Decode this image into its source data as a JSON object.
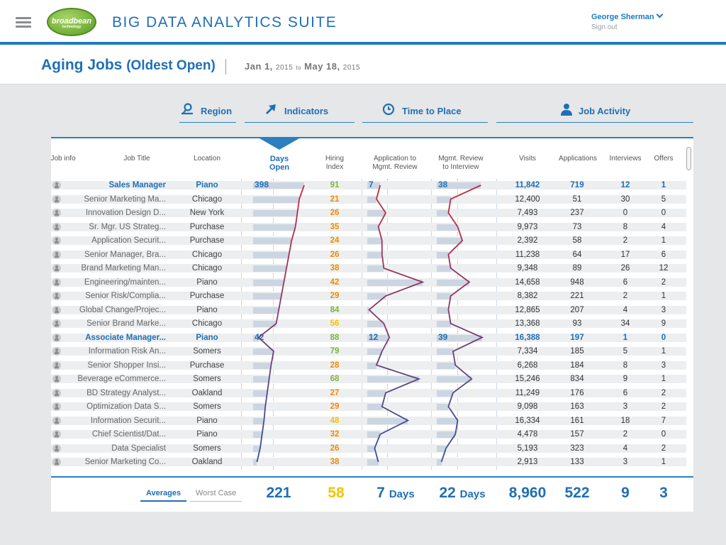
{
  "app": {
    "logo_text": "broadbean",
    "logo_sub": "technology",
    "title": "BIG DATA ANALYTICS SUITE",
    "user": "George Sherman",
    "signout": "Sign out"
  },
  "page": {
    "title": "Aging Jobs",
    "subtitle": "(Oldest Open)",
    "date_from": "Jan 1,",
    "year_from": "2015",
    "to": "to",
    "date_to": "May 18,",
    "year_to": "2015"
  },
  "tabs": [
    {
      "label": "Region",
      "icon": "map-pin-icon"
    },
    {
      "label": "Indicators",
      "icon": "arrow-up-right-icon"
    },
    {
      "label": "Time to Place",
      "icon": "clock-icon"
    },
    {
      "label": "Job Activity",
      "icon": "person-icon"
    }
  ],
  "columns": {
    "job_info": "Job info",
    "job_title": "Job Title",
    "location": "Location",
    "days_open_1": "Days",
    "days_open_2": "Open",
    "hiring_1": "Hiring",
    "hiring_2": "Index",
    "app_1": "Application to",
    "app_2": "Mgmt. Review",
    "mgmt_1": "Mgmt. Review",
    "mgmt_2": "to Interview",
    "visits": "Visits",
    "applications": "Applications",
    "interviews": "Interviews",
    "offers": "Offers"
  },
  "rows": [
    {
      "title": "Sales Manager",
      "location": "Piano",
      "days": 398,
      "hiring": 91,
      "app": 7,
      "mgmt": 38,
      "visits": "11,842",
      "applications": "719",
      "interviews": "12",
      "offers": "1",
      "highlight": true
    },
    {
      "title": "Senior Marketing Ma...",
      "location": "Chicago",
      "days": 360,
      "hiring": 21,
      "app": 5,
      "mgmt": 12,
      "visits": "12,400",
      "applications": "51",
      "interviews": "30",
      "offers": "5",
      "highlight": false
    },
    {
      "title": "Innovation Design D...",
      "location": "New York",
      "days": 345,
      "hiring": 26,
      "app": 10,
      "mgmt": 10,
      "visits": "7,493",
      "applications": "237",
      "interviews": "0",
      "offers": "0",
      "highlight": false
    },
    {
      "title": "Sr. Mgr. US Strateg...",
      "location": "Purchase",
      "days": 330,
      "hiring": 35,
      "app": 6,
      "mgmt": 18,
      "visits": "9,973",
      "applications": "73",
      "interviews": "8",
      "offers": "4",
      "highlight": false
    },
    {
      "title": "Application Securit...",
      "location": "Purchase",
      "days": 300,
      "hiring": 24,
      "app": 8,
      "mgmt": 22,
      "visits": "2,392",
      "applications": "58",
      "interviews": "2",
      "offers": "1",
      "highlight": false
    },
    {
      "title": "Senior Manager, Bra...",
      "location": "Chicago",
      "days": 280,
      "hiring": 26,
      "app": 8,
      "mgmt": 10,
      "visits": "11,238",
      "applications": "64",
      "interviews": "17",
      "offers": "6",
      "highlight": false
    },
    {
      "title": "Brand Marketing Man...",
      "location": "Chicago",
      "days": 260,
      "hiring": 38,
      "app": 9,
      "mgmt": 12,
      "visits": "9,348",
      "applications": "89",
      "interviews": "26",
      "offers": "12",
      "highlight": false
    },
    {
      "title": "Engineering/mainten...",
      "location": "Piano",
      "days": 240,
      "hiring": 42,
      "app": 30,
      "mgmt": 28,
      "visits": "14,658",
      "applications": "948",
      "interviews": "6",
      "offers": "2",
      "highlight": false
    },
    {
      "title": "Senior Risk/Complia...",
      "location": "Purchase",
      "days": 220,
      "hiring": 29,
      "app": 10,
      "mgmt": 12,
      "visits": "8,382",
      "applications": "221",
      "interviews": "2",
      "offers": "1",
      "highlight": false
    },
    {
      "title": "Global Change/Projec...",
      "location": "Piano",
      "days": 200,
      "hiring": 84,
      "app": 1,
      "mgmt": 10,
      "visits": "12,865",
      "applications": "207",
      "interviews": "4",
      "offers": "3",
      "highlight": false
    },
    {
      "title": "Senior Brand Marke...",
      "location": "Chicago",
      "days": 180,
      "hiring": 56,
      "app": 9,
      "mgmt": 12,
      "visits": "13,368",
      "applications": "93",
      "interviews": "34",
      "offers": "9",
      "highlight": false
    },
    {
      "title": "Associate Manager...",
      "location": "Piano",
      "days": 42,
      "hiring": 88,
      "app": 12,
      "mgmt": 39,
      "visits": "16,388",
      "applications": "197",
      "interviews": "1",
      "offers": "0",
      "highlight": true
    },
    {
      "title": "Information Risk An...",
      "location": "Somers",
      "days": 160,
      "hiring": 79,
      "app": 8,
      "mgmt": 14,
      "visits": "7,334",
      "applications": "185",
      "interviews": "5",
      "offers": "1",
      "highlight": false
    },
    {
      "title": "Senior Shopper Insi...",
      "location": "Purchase",
      "days": 140,
      "hiring": 28,
      "app": 5,
      "mgmt": 16,
      "visits": "6,268",
      "applications": "184",
      "interviews": "8",
      "offers": "3",
      "highlight": false
    },
    {
      "title": "Beverage eCommerce...",
      "location": "Somers",
      "days": 125,
      "hiring": 68,
      "app": 28,
      "mgmt": 30,
      "visits": "15,246",
      "applications": "834",
      "interviews": "9",
      "offers": "1",
      "highlight": false
    },
    {
      "title": "BD Strategy Analyst...",
      "location": "Oakland",
      "days": 110,
      "hiring": 27,
      "app": 10,
      "mgmt": 14,
      "visits": "11,249",
      "applications": "176",
      "interviews": "6",
      "offers": "2",
      "highlight": false
    },
    {
      "title": "Optimization Data S...",
      "location": "Somers",
      "days": 95,
      "hiring": 29,
      "app": 8,
      "mgmt": 10,
      "visits": "9,098",
      "applications": "163",
      "interviews": "3",
      "offers": "2",
      "highlight": false
    },
    {
      "title": "Information Securit...",
      "location": "Piano",
      "days": 85,
      "hiring": 48,
      "app": 22,
      "mgmt": 18,
      "visits": "16,334",
      "applications": "161",
      "interviews": "18",
      "offers": "7",
      "highlight": false
    },
    {
      "title": "Chief Scientist/Dat...",
      "location": "Piano",
      "days": 70,
      "hiring": 32,
      "app": 7,
      "mgmt": 16,
      "visits": "4,478",
      "applications": "157",
      "interviews": "2",
      "offers": "0",
      "highlight": false
    },
    {
      "title": "Data Specialist",
      "location": "Somers",
      "days": 55,
      "hiring": 26,
      "app": 4,
      "mgmt": 8,
      "visits": "5,193",
      "applications": "323",
      "interviews": "4",
      "offers": "2",
      "highlight": false
    },
    {
      "title": "Senior Marketing Co...",
      "location": "Oakland",
      "days": 30,
      "hiring": 38,
      "app": 6,
      "mgmt": 4,
      "visits": "2,913",
      "applications": "133",
      "interviews": "3",
      "offers": "1",
      "highlight": false
    }
  ],
  "footer": {
    "tab_averages": "Averages",
    "tab_worst": "Worst Case",
    "days": "221",
    "hiring": "58",
    "app_val": "7",
    "app_unit": "Days",
    "mgmt_val": "22",
    "mgmt_unit": "Days",
    "visits": "8,960",
    "applications": "522",
    "interviews": "9",
    "offers": "3"
  },
  "colors": {
    "accent": "#1f6fb5",
    "line_red": "#c8283c",
    "line_blue": "#3050a0",
    "hiring_low": "#f28c00",
    "hiring_mid": "#f2c400",
    "hiring_high": "#7cb740"
  }
}
